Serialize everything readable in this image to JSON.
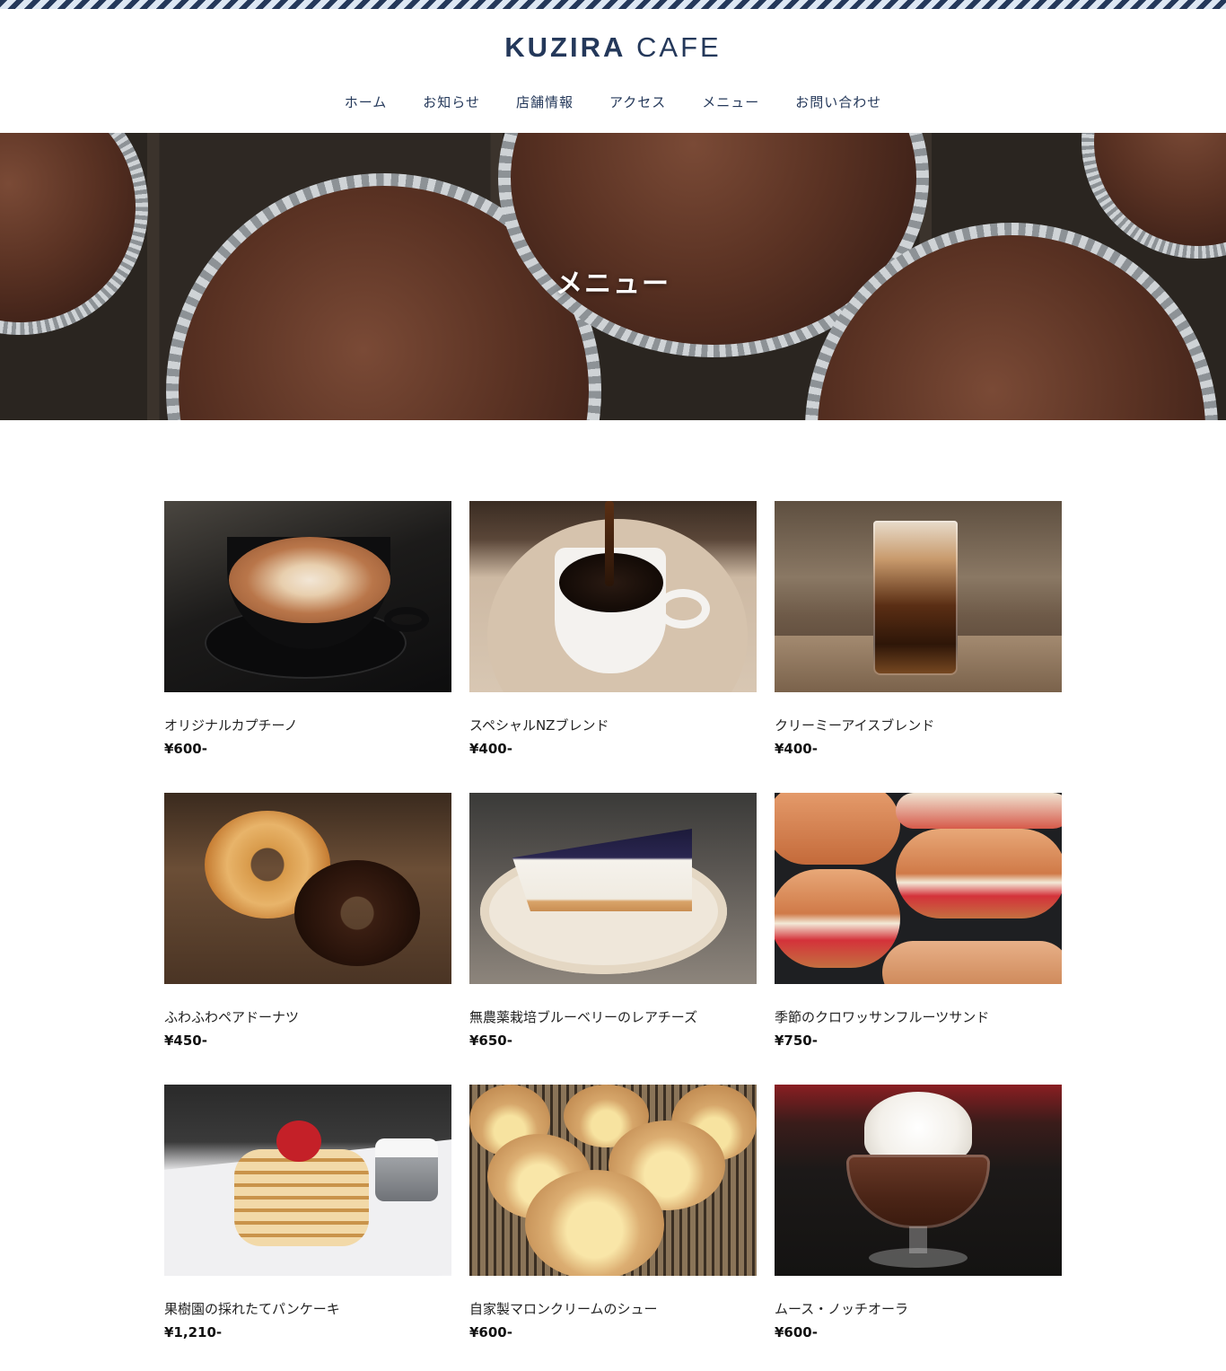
{
  "header": {
    "logo_bold": "KUZIRA",
    "logo_light": "CAFE",
    "colors": {
      "brand": "#24385a",
      "stripe_light": "#dde7f3"
    }
  },
  "nav": {
    "items": [
      {
        "label": "ホーム"
      },
      {
        "label": "お知らせ"
      },
      {
        "label": "店舗情報"
      },
      {
        "label": "アクセス"
      },
      {
        "label": "メニュー"
      },
      {
        "label": "お問い合わせ"
      }
    ]
  },
  "hero": {
    "title": "メニュー",
    "image": "chocolate-muffins-photo"
  },
  "menu": {
    "items": [
      {
        "name": "オリジナルカプチーノ",
        "price": "¥600-",
        "image": "cappuccino-photo"
      },
      {
        "name": "スペシャルNZブレンド",
        "price": "¥400-",
        "image": "coffee-pour-photo"
      },
      {
        "name": "クリーミーアイスブレンド",
        "price": "¥400-",
        "image": "iced-latte-photo"
      },
      {
        "name": "ふわふわペアドーナツ",
        "price": "¥450-",
        "image": "donuts-photo"
      },
      {
        "name": "無農薬栽培ブルーベリーのレアチーズ",
        "price": "¥650-",
        "image": "blueberry-cheesecake-photo"
      },
      {
        "name": "季節のクロワッサンフルーツサンド",
        "price": "¥750-",
        "image": "croissant-sandwich-photo"
      },
      {
        "name": "果樹園の採れたてパンケーキ",
        "price": "¥1,210-",
        "image": "pancakes-photo"
      },
      {
        "name": "自家製マロンクリームのシュー",
        "price": "¥600-",
        "image": "cream-puffs-photo"
      },
      {
        "name": "ムース・ノッチオーラ",
        "price": "¥600-",
        "image": "chocolate-mousse-photo"
      }
    ]
  }
}
